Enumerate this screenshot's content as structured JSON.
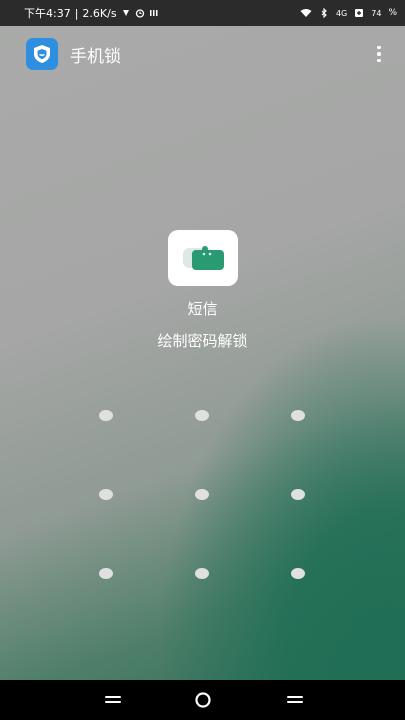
{
  "status_bar": {
    "time": "下午4:37",
    "separator": "|",
    "speed": "2.6K/s",
    "network": "4G",
    "battery": "74",
    "percent_sign": "%"
  },
  "app_bar": {
    "title": "手机锁",
    "app_icon": "shield-icon",
    "menu_icon": "more-vert-icon"
  },
  "lock_screen": {
    "target_app_icon": "messages-icon",
    "target_app_name": "短信",
    "hint": "绘制密码解锁"
  },
  "pattern": {
    "rows": 3,
    "cols": 3,
    "color": "#e0e0e0"
  },
  "nav_bar": {
    "left": "menu-icon",
    "center": "home-icon",
    "right": "back-icon"
  },
  "colors": {
    "status_bg": "#2b2b2b",
    "app_icon_bg": "#2e8fe0",
    "message_green": "#2a9a72",
    "gradient_green": "#1f6e55"
  }
}
